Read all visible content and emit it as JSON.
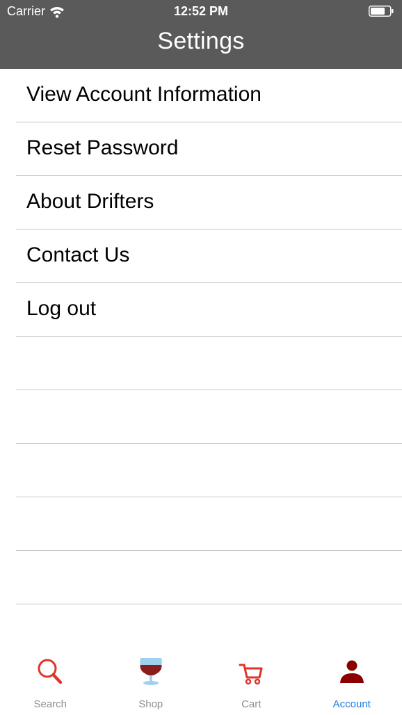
{
  "status_bar": {
    "carrier": "Carrier",
    "time": "12:52 PM",
    "icons": [
      "wifi-icon",
      "battery-icon"
    ]
  },
  "nav": {
    "title": "Settings"
  },
  "menu": {
    "items": [
      {
        "label": "View Account Information"
      },
      {
        "label": "Reset Password"
      },
      {
        "label": "About Drifters"
      },
      {
        "label": "Contact Us"
      },
      {
        "label": "Log out"
      }
    ],
    "empty_rows": 5
  },
  "tabbar": {
    "tabs": [
      {
        "label": "Search",
        "icon": "search-icon",
        "active": false
      },
      {
        "label": "Shop",
        "icon": "wine-glass-icon",
        "active": false
      },
      {
        "label": "Cart",
        "icon": "cart-icon",
        "active": false
      },
      {
        "label": "Account",
        "icon": "person-icon",
        "active": true
      }
    ]
  },
  "colors": {
    "header_bg": "#5a5a5a",
    "accent_blue": "#1a7ae2",
    "icon_red": "#e0332b",
    "account_icon": "#8b0000",
    "wine": "#8b1c1c",
    "separator": "#c8c7cc"
  }
}
